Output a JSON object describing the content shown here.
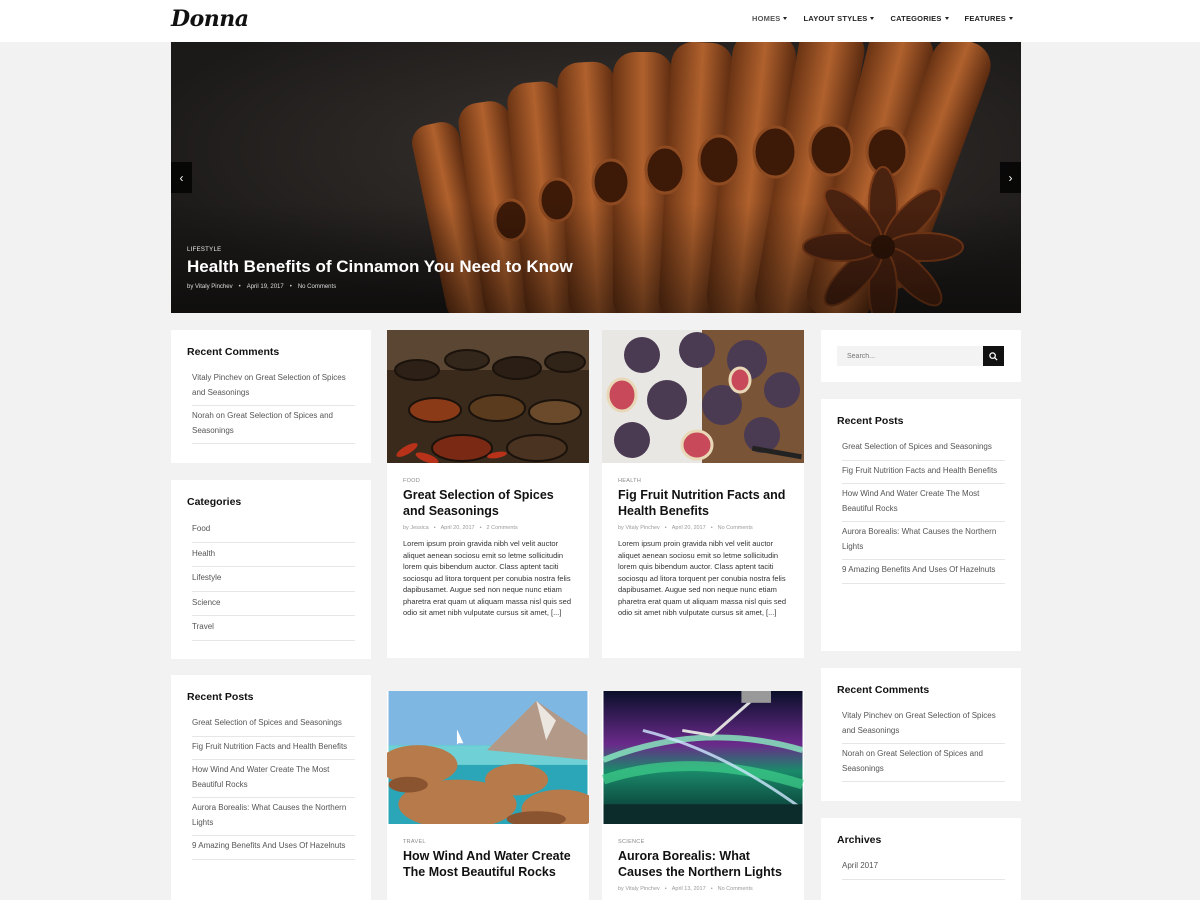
{
  "site": {
    "logo": "Donna"
  },
  "nav": [
    {
      "label": "HOMES"
    },
    {
      "label": "LAYOUT STYLES"
    },
    {
      "label": "CATEGORIES"
    },
    {
      "label": "FEATURES"
    }
  ],
  "hero": {
    "category": "LIFESTYLE",
    "title": "Health Benefits of Cinnamon You Need to Know",
    "author": "by Vitaly Pinchev",
    "date": "April 19, 2017",
    "comments": "No Comments",
    "prev_icon": "‹",
    "next_icon": "›"
  },
  "left": {
    "recent_comments": {
      "title": "Recent Comments",
      "items": [
        "Vitaly Pinchev on Great Selection of Spices and Seasonings",
        "Norah on Great Selection of Spices and Seasonings"
      ]
    },
    "categories": {
      "title": "Categories",
      "items": [
        "Food",
        "Health",
        "Lifestyle",
        "Science",
        "Travel"
      ]
    },
    "recent_posts": {
      "title": "Recent Posts",
      "items": [
        "Great Selection of Spices and Seasonings",
        "Fig Fruit Nutrition Facts and Health Benefits",
        "How Wind And Water Create The Most Beautiful Rocks",
        "Aurora Borealis: What Causes the Northern Lights",
        "9 Amazing Benefits And Uses Of Hazelnuts"
      ]
    }
  },
  "posts": [
    {
      "category": "FOOD",
      "title": "Great Selection of Spices and Seasonings",
      "author": "by Jessica",
      "date": "April 20, 2017",
      "comments": "2 Comments",
      "excerpt": "Lorem ipsum proin gravida nibh vel velit auctor aliquet aenean sociosu emit so letme sollicitudin lorem quis bibendum auctor. Class aptent taciti sociosqu ad litora torquent per conubia nostra felis dapibusamet. Augue sed non neque nunc etiam pharetra erat quam ut aliquam massa nisl quis sed odio sit amet nibh vulputate cursus sit amet, [...]"
    },
    {
      "category": "HEALTH",
      "title": "Fig Fruit Nutrition Facts and Health Benefits",
      "author": "by Vitaly Pinchev",
      "date": "April 20, 2017",
      "comments": "No Comments",
      "excerpt": "Lorem ipsum proin gravida nibh vel velit auctor aliquet aenean sociosu emit so letme sollicitudin lorem quis bibendum auctor. Class aptent taciti sociosqu ad litora torquent per conubia nostra felis dapibusamet. Augue sed non neque nunc etiam pharetra erat quam ut aliquam massa nisl quis sed odio sit amet nibh vulputate cursus sit amet, [...]"
    },
    {
      "category": "TRAVEL",
      "title": "How Wind And Water Create The Most Beautiful Rocks"
    },
    {
      "category": "SCIENCE",
      "title": "Aurora Borealis: What Causes the Northern Lights",
      "author": "by Vitaly Pinchev",
      "date": "April 13, 2017",
      "comments": "No Comments"
    }
  ],
  "right": {
    "search": {
      "placeholder": "Search..."
    },
    "recent_posts": {
      "title": "Recent Posts",
      "items": [
        "Great Selection of Spices and Seasonings",
        "Fig Fruit Nutrition Facts and Health Benefits",
        "How Wind And Water Create The Most Beautiful Rocks",
        "Aurora Borealis: What Causes the Northern Lights",
        "9 Amazing Benefits And Uses Of Hazelnuts"
      ]
    },
    "recent_comments": {
      "title": "Recent Comments",
      "items": [
        "Vitaly Pinchev on Great Selection of Spices and Seasonings",
        "Norah on Great Selection of Spices and Seasonings"
      ]
    },
    "archives": {
      "title": "Archives",
      "items": [
        "April 2017"
      ]
    }
  }
}
